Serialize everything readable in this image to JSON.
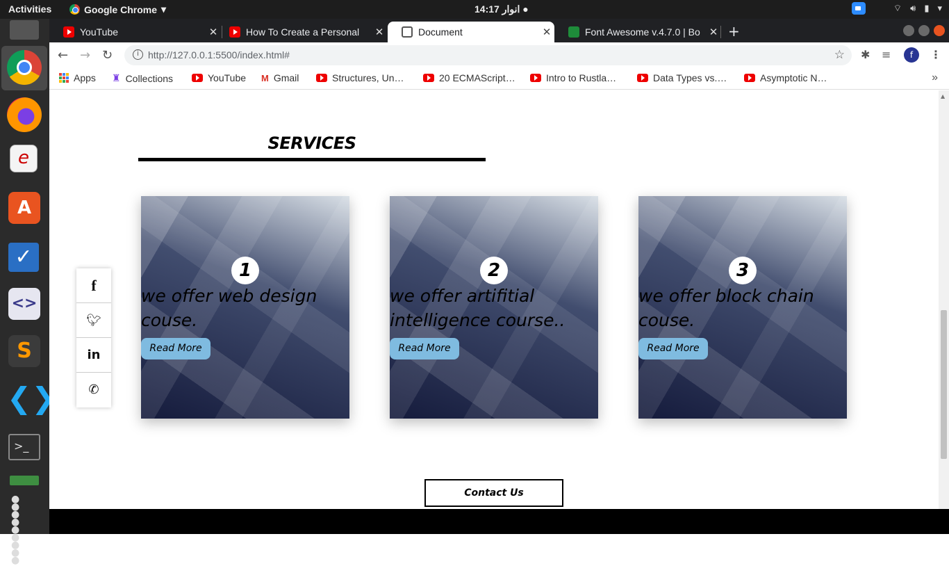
{
  "system": {
    "activities": "Activities",
    "app_name": "Google Chrome",
    "clock": "انوار 14:17 ●"
  },
  "browser": {
    "tabs": [
      {
        "title": "YouTube",
        "active": false
      },
      {
        "title": "How To Create a Personal",
        "active": false
      },
      {
        "title": "Document",
        "active": true
      },
      {
        "title": "Font Awesome v.4.7.0 | Bo",
        "active": false
      }
    ],
    "url": "http://127.0.0.1:5500/index.html#",
    "profile_initial": "f",
    "bookmarks": [
      "Apps",
      "Collections",
      "YouTube",
      "Gmail",
      "Structures, Un…",
      "20 ECMAScript…",
      "Intro to Rustla…",
      "Data Types vs.…",
      "Asymptotic N…"
    ]
  },
  "page": {
    "section_title": "SERVICES",
    "cards": [
      {
        "number": "1",
        "text": "we offer web design couse.",
        "button": "Read More"
      },
      {
        "number": "2",
        "text": "we offer artifitial intelligence course..",
        "button": "Read More"
      },
      {
        "number": "3",
        "text": "we offer block chain couse.",
        "button": "Read More"
      }
    ],
    "social": [
      "facebook-icon",
      "twitter-icon",
      "linkedin-icon",
      "whatsapp-icon"
    ],
    "contact_button": "Contact Us"
  },
  "colors": {
    "read_more_bg": "#7fbbe0",
    "card_dark": "#151b3c",
    "footer": "#000000"
  }
}
